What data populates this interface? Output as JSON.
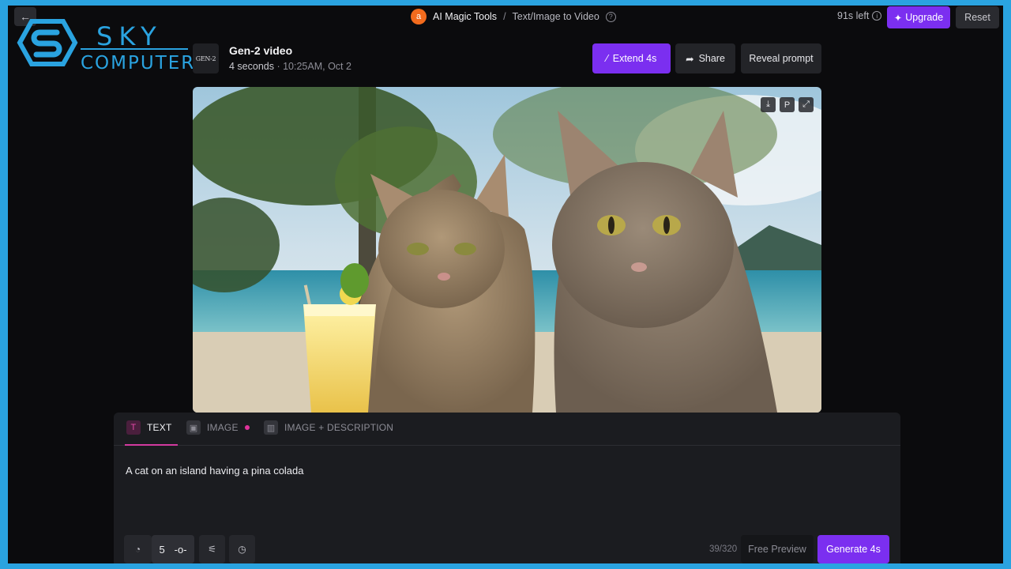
{
  "topbar": {
    "back_icon": "arrow-left-icon",
    "avatar_letter": "a",
    "breadcrumb_tools": "AI Magic Tools",
    "breadcrumb_sep": "/",
    "breadcrumb_page": "Text/Image to Video",
    "help_icon": "?",
    "credits": "91s left",
    "upgrade_label": "Upgrade",
    "reset_label": "Reset",
    "accent": "#7b2ff0"
  },
  "watermark": {
    "line1": "SKY",
    "line2": "COMPUTER",
    "color": "#2aa3e0"
  },
  "video": {
    "thumb_label": "GEN-2",
    "title": "Gen-2 video",
    "duration": "4 seconds",
    "meta_sep": " · ",
    "timestamp": "10:25AM, Oct 2",
    "extend_label": "Extend 4s",
    "share_label": "Share",
    "reveal_label": "Reveal prompt",
    "controls": [
      "download-icon",
      "pin-icon",
      "fullscreen-icon"
    ]
  },
  "panel": {
    "tabs": [
      {
        "label": "TEXT",
        "icon": "T",
        "active": true
      },
      {
        "label": "IMAGE",
        "icon": "▣",
        "active": false
      },
      {
        "label": "IMAGE + DESCRIPTION",
        "icon": "▥",
        "active": false
      }
    ],
    "prompt": "A cat on an island having a pina colada",
    "motion_value": "5",
    "char_count": "39/320",
    "preview_label": "Free Preview",
    "generate_label": "Generate 4s"
  }
}
